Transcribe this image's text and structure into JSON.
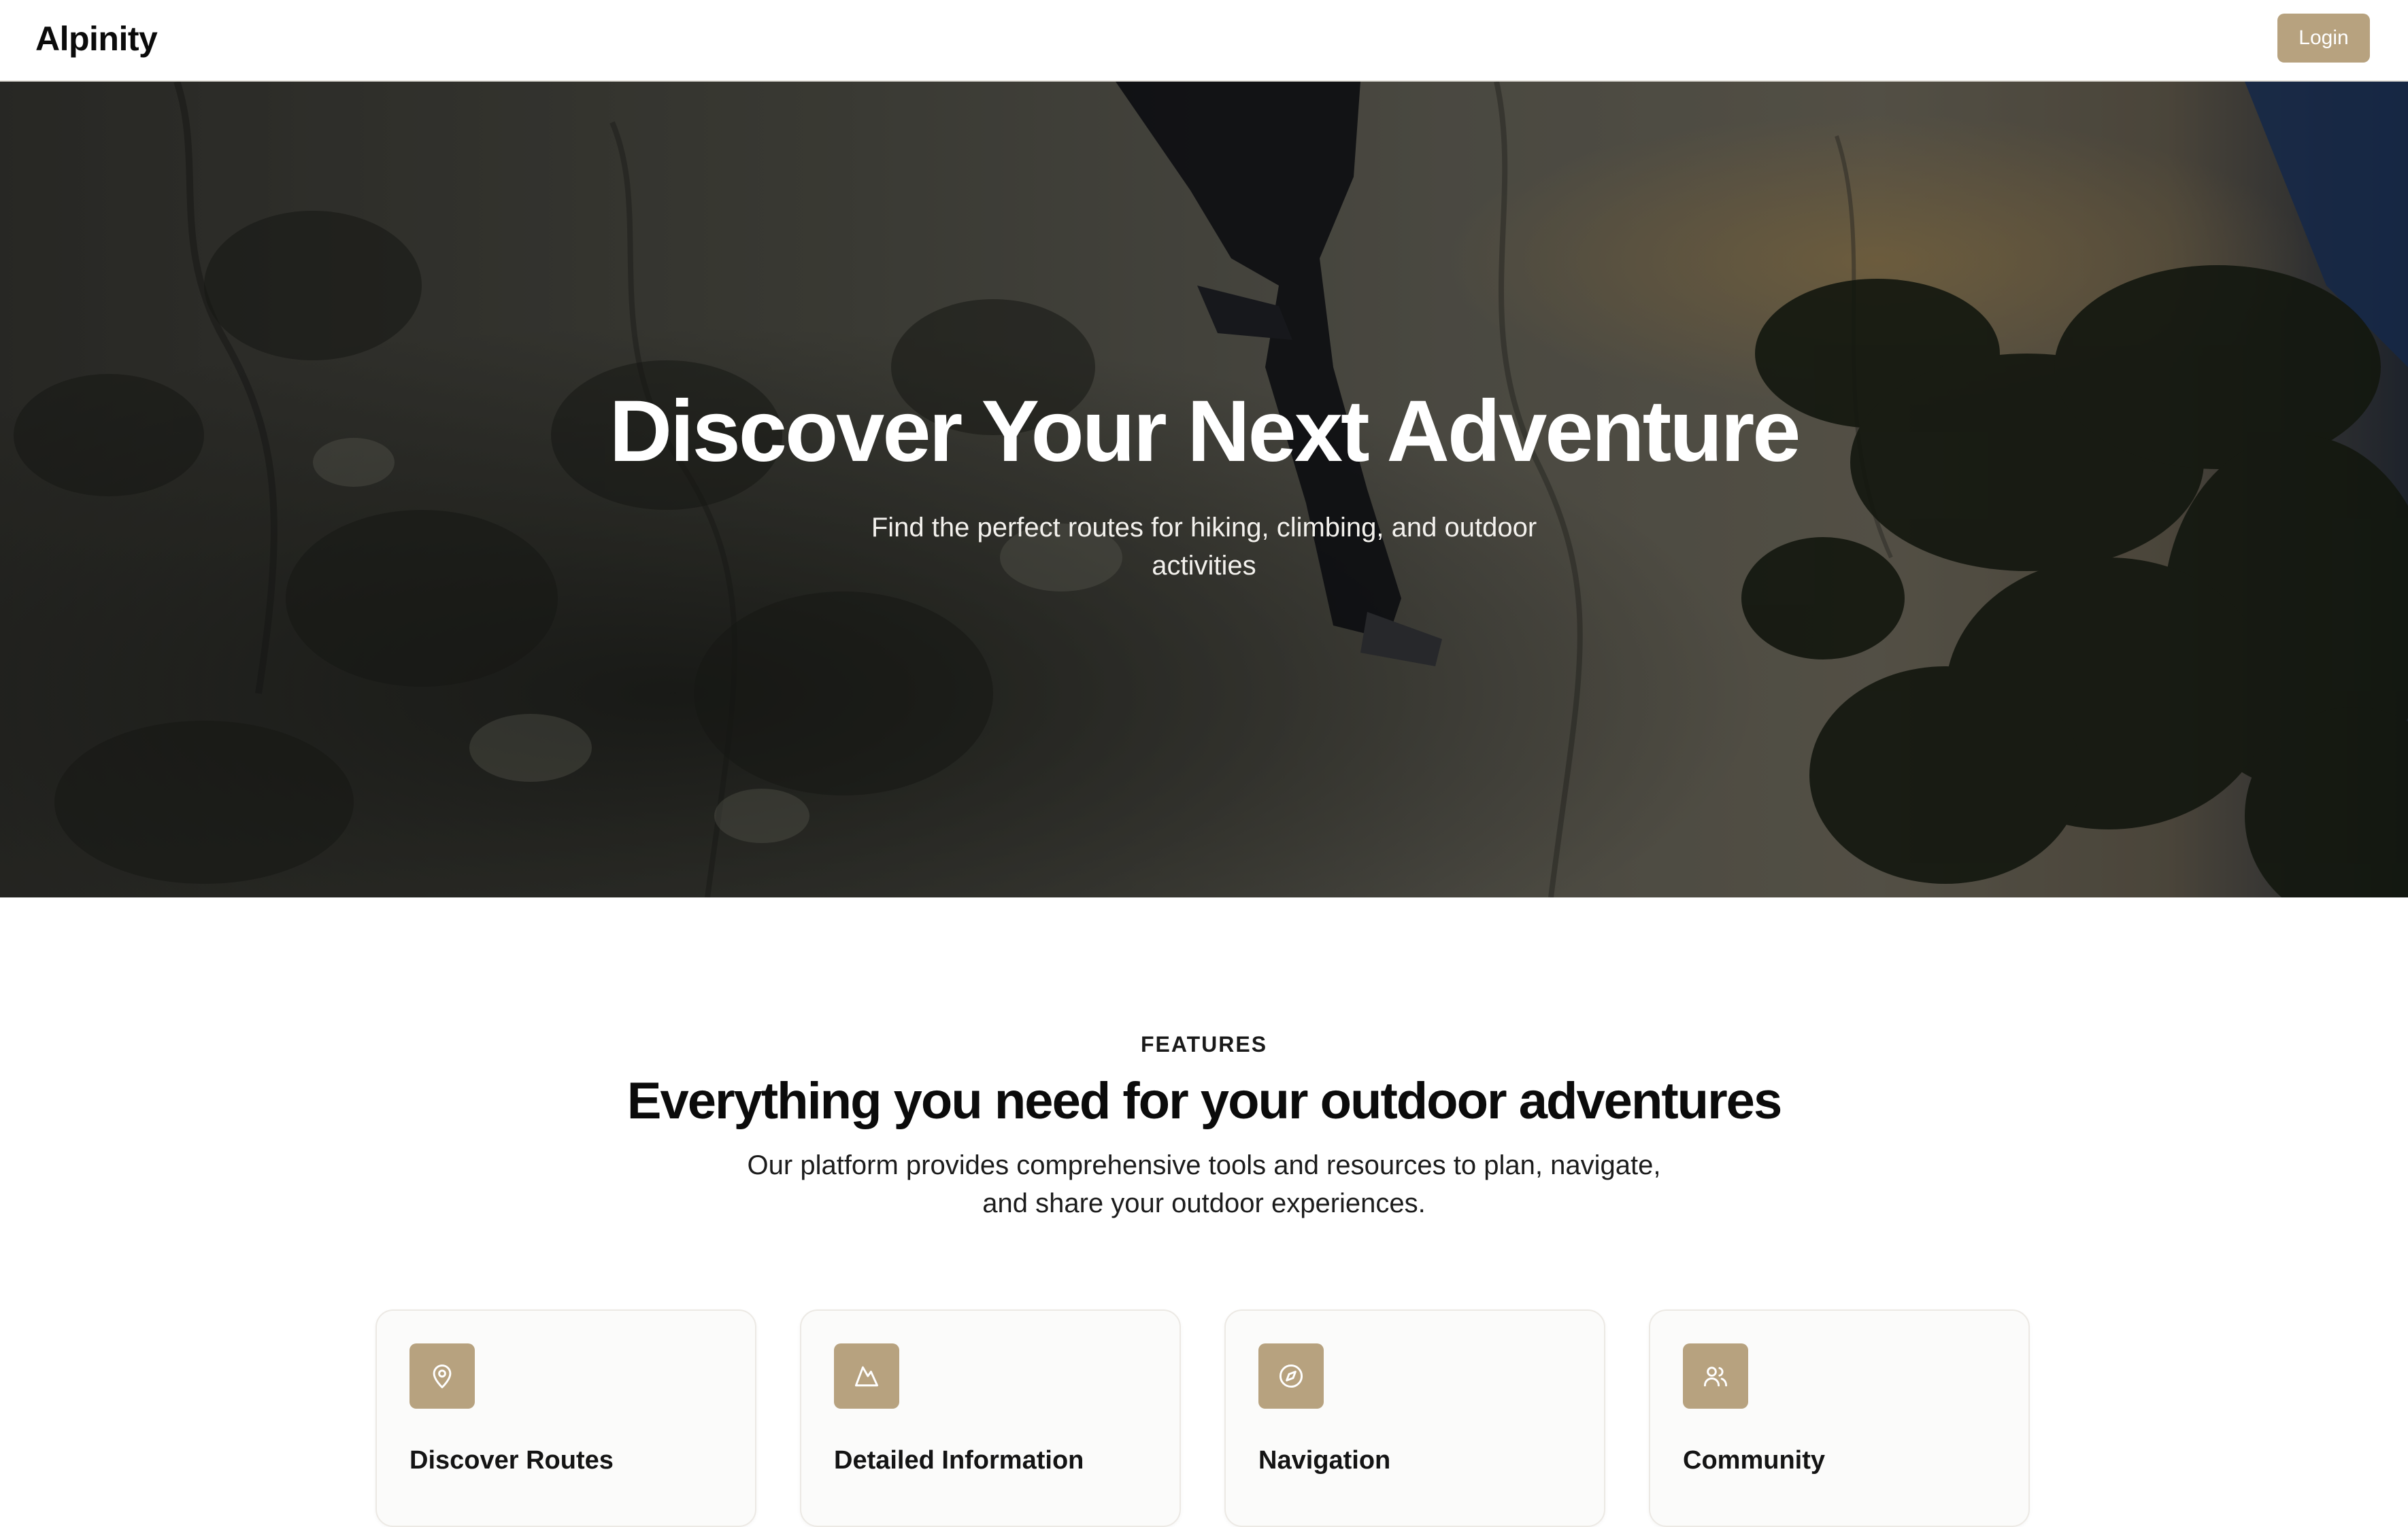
{
  "header": {
    "brand": "Alpinity",
    "login_label": "Login"
  },
  "hero": {
    "title": "Discover Your Next Adventure",
    "subtitle": "Find the perfect routes for hiking, climbing, and outdoor activities"
  },
  "features": {
    "eyebrow": "FEATURES",
    "title": "Everything you need for your outdoor adventures",
    "description": "Our platform provides comprehensive tools and resources to plan, navigate, and share your outdoor experiences.",
    "cards": [
      {
        "title": "Discover Routes",
        "icon": "map-pin-icon"
      },
      {
        "title": "Detailed Information",
        "icon": "mountain-icon"
      },
      {
        "title": "Navigation",
        "icon": "compass-icon"
      },
      {
        "title": "Community",
        "icon": "users-icon"
      }
    ]
  },
  "colors": {
    "accent": "#b7a27f",
    "text": "#0b0b0b",
    "card_background": "#fbfbfa",
    "card_border": "#ece9e4"
  }
}
